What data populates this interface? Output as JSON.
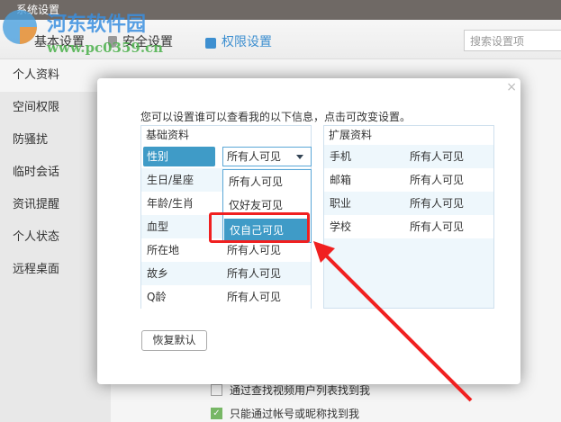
{
  "window": {
    "title": "系统设置"
  },
  "watermark": {
    "name": "河东软件园",
    "url": "www.pc0359.cn"
  },
  "tabs": [
    {
      "label": "基本设置"
    },
    {
      "label": "安全设置"
    },
    {
      "label": "权限设置"
    }
  ],
  "search": {
    "placeholder": "搜索设置项"
  },
  "sidebar": {
    "items": [
      {
        "label": "个人资料"
      },
      {
        "label": "空间权限"
      },
      {
        "label": "防骚扰"
      },
      {
        "label": "临时会话"
      },
      {
        "label": "资讯提醒"
      },
      {
        "label": "个人状态"
      },
      {
        "label": "远程桌面"
      }
    ]
  },
  "main": {
    "options": [
      {
        "label": "通过查找视频用户列表找到我",
        "checked": false
      },
      {
        "label": "只能通过帐号或昵称找到我",
        "checked": true
      }
    ]
  },
  "modal": {
    "intro": "您可以设置谁可以查看我的以下信息，点击可改变设置。",
    "basic": {
      "title": "基础资料",
      "rows": [
        {
          "k": "性别",
          "v": "所有人可见"
        },
        {
          "k": "生日/星座",
          "v": ""
        },
        {
          "k": "年龄/生肖",
          "v": ""
        },
        {
          "k": "血型",
          "v": ""
        },
        {
          "k": "所在地",
          "v": "所有人可见"
        },
        {
          "k": "故乡",
          "v": "所有人可见"
        },
        {
          "k": "Q龄",
          "v": "所有人可见"
        }
      ]
    },
    "ext": {
      "title": "扩展资料",
      "rows": [
        {
          "k": "手机",
          "v": "所有人可见"
        },
        {
          "k": "邮箱",
          "v": "所有人可见"
        },
        {
          "k": "职业",
          "v": "所有人可见"
        },
        {
          "k": "学校",
          "v": "所有人可见"
        }
      ]
    },
    "dropdown": {
      "options": [
        "所有人可见",
        "仅好友可见",
        "仅自己可见"
      ],
      "highlighted": "仅自己可见"
    },
    "restore_label": "恢复默认",
    "close": "×"
  },
  "colors": {
    "accent": "#3f9bc7",
    "annotation": "#f02020"
  }
}
